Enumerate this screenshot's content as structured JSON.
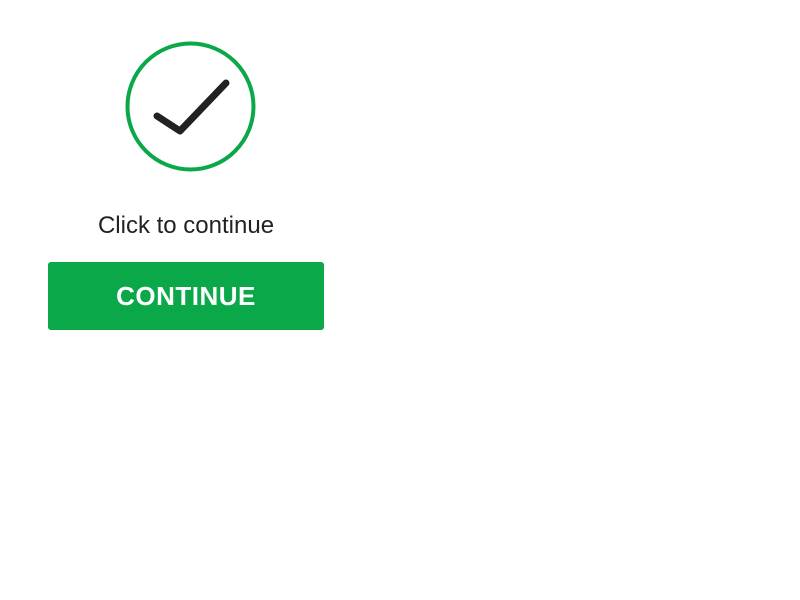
{
  "colors": {
    "accent": "#0ba84a",
    "check_ring": "#0ba84a",
    "check_mark": "#222222",
    "text": "#222222",
    "button_text": "#ffffff"
  },
  "status": {
    "icon": "check-circle-icon"
  },
  "prompt": {
    "text": "Click to continue"
  },
  "continue_button": {
    "label": "CONTINUE"
  }
}
